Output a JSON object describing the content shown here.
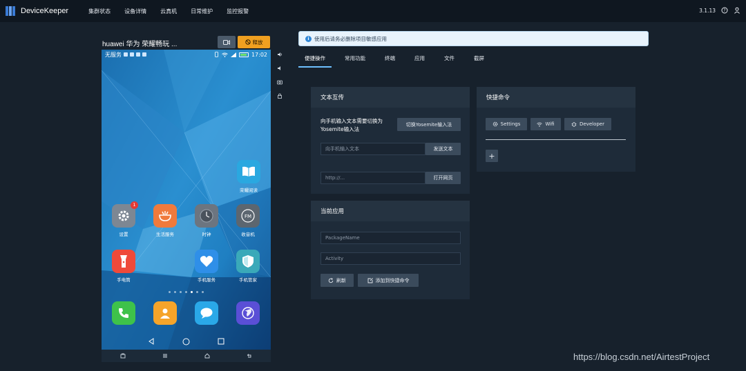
{
  "app": {
    "name": "DeviceKeeper",
    "version": "3.1.13",
    "nav": [
      "集群状态",
      "设备详情",
      "云真机",
      "日常维护",
      "监控报警"
    ]
  },
  "device": {
    "title": "huawei 华为 荣耀畅玩 ...",
    "release_label": "释放",
    "status_left": "无服务",
    "time": "17:02",
    "apps": [
      {
        "label": "荣耀阅读",
        "icon": "book-icon",
        "color": "#2aa8e0"
      },
      {
        "label": "设置",
        "icon": "gear-icon",
        "color": "#7d8793",
        "badge": "1"
      },
      {
        "label": "生活服务",
        "icon": "bowl-icon",
        "color": "#f07a3c"
      },
      {
        "label": "时钟",
        "icon": "clock-icon",
        "color": "#6c7580"
      },
      {
        "label": "收音机",
        "icon": "radio-icon",
        "color": "#5c6670"
      },
      {
        "label": "手电筒",
        "icon": "flashlight-icon",
        "color": "#ef4a3a"
      },
      {
        "label": "手机服务",
        "icon": "heart-icon",
        "color": "#2f8fe8"
      },
      {
        "label": "手机管家",
        "icon": "shield-icon",
        "color": "#3aa9b9"
      },
      {
        "label": "",
        "icon": "phone-icon",
        "color": "#3ec24a"
      },
      {
        "label": "",
        "icon": "contacts-icon",
        "color": "#f5a42a"
      },
      {
        "label": "",
        "icon": "message-icon",
        "color": "#2aa8e8"
      },
      {
        "label": "",
        "icon": "browser-icon",
        "color": "#5a4fd6"
      }
    ]
  },
  "alert": {
    "text": "使用后请务必删除项目敏感应用"
  },
  "tabs": [
    "便捷操作",
    "常用功能",
    "终端",
    "应用",
    "文件",
    "截屏"
  ],
  "text_transfer": {
    "title": "文本互传",
    "hint_line1": "向手机输入文本需要切换为",
    "hint_line2": "Yosemite输入法",
    "switch_ime_label": "切换Yosemite输入法",
    "text_placeholder": "向手机输入文本",
    "send_label": "发送文本",
    "url_placeholder": "http://...",
    "open_label": "打开网页"
  },
  "current_app": {
    "title": "当前应用",
    "package_placeholder": "PackageName",
    "activity_placeholder": "Activity",
    "refresh_label": "刷新",
    "add_shortcut_label": "添加到快捷命令"
  },
  "shortcuts": {
    "title": "快捷命令",
    "buttons": [
      "Settings",
      "Wifi",
      "Developer"
    ],
    "add_label": "+"
  },
  "watermark": "https://blog.csdn.net/AirtestProject"
}
